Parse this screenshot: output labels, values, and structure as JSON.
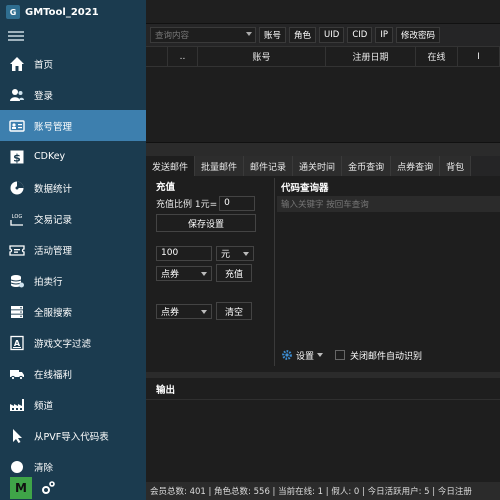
{
  "app": {
    "title": "GMTool_2021"
  },
  "sidebar": {
    "items": [
      {
        "label": "首页",
        "icon": "home-icon"
      },
      {
        "label": "登录",
        "icon": "users-icon"
      },
      {
        "label": "账号管理",
        "icon": "id-card-icon",
        "active": true
      },
      {
        "label": "CDKey",
        "icon": "dollar-icon"
      },
      {
        "label": "数据统计",
        "icon": "chart-disk-icon"
      },
      {
        "label": "交易记录",
        "icon": "log-icon"
      },
      {
        "label": "活动管理",
        "icon": "ticket-icon"
      },
      {
        "label": "拍卖行",
        "icon": "coins-icon"
      },
      {
        "label": "全服搜索",
        "icon": "server-icon"
      },
      {
        "label": "游戏文字过滤",
        "icon": "text-filter-icon"
      },
      {
        "label": "在线福利",
        "icon": "truck-icon"
      },
      {
        "label": "频道",
        "icon": "factory-icon"
      },
      {
        "label": "从PVF导入代码表",
        "icon": "cursor-icon"
      },
      {
        "label": "清除",
        "icon": "clear-icon"
      }
    ],
    "bottom": {
      "m_label": "M"
    }
  },
  "toolbar": {
    "search_placeholder": "查询内容",
    "buttons": [
      "账号",
      "角色",
      "UID",
      "CID",
      "IP",
      "修改密码"
    ]
  },
  "table": {
    "columns": [
      "..",
      "账号",
      "注册日期",
      "在线",
      "I"
    ]
  },
  "tabs": [
    "发送邮件",
    "批量邮件",
    "邮件记录",
    "通关时间",
    "金币查询",
    "点券查询",
    "背包"
  ],
  "recharge": {
    "title": "充值",
    "ratio_label": "充值比例 1元=",
    "ratio_value": "0",
    "save_button": "保存设置",
    "amount_value": "100",
    "unit_select": "元",
    "currency_select": "点券",
    "recharge_button": "充值",
    "clear_select": "点券",
    "clear_button": "清空"
  },
  "code_query": {
    "title": "代码查询器",
    "search_placeholder": "输入关键字 按回车查询",
    "settings_label": "设置",
    "auto_recog_label": "关闭邮件自动识别"
  },
  "output": {
    "title": "输出"
  },
  "status": {
    "text": "会员总数: 401 | 角色总数: 556 | 当前在线: 1 | 假人: 0 | 今日活跃用户: 5 | 今日注册"
  }
}
